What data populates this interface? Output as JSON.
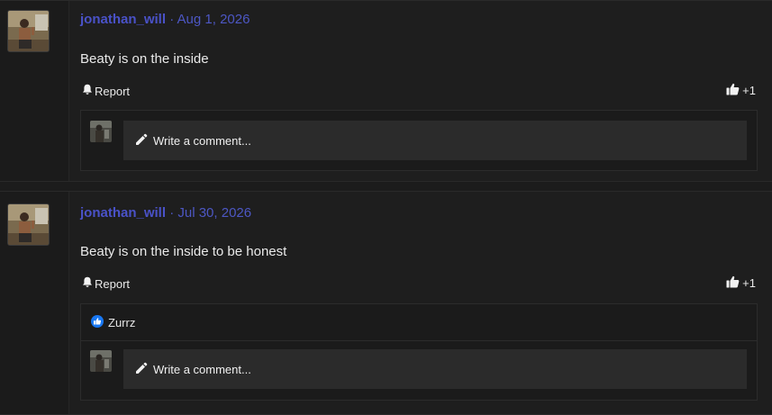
{
  "posts": [
    {
      "username": "jonathan_will",
      "separator": "·",
      "date": "Aug 1, 2026",
      "text": "Beaty is on the inside",
      "report_label": "Report",
      "like_label": "+1",
      "reactions": null,
      "comment_placeholder": "Write a comment..."
    },
    {
      "username": "jonathan_will",
      "separator": "·",
      "date": "Jul 30, 2026",
      "text": "Beaty is on the inside to be honest",
      "report_label": "Report",
      "like_label": "+1",
      "reactions": {
        "icon": "thumbs-up-reaction-icon",
        "user": "Zurrz"
      },
      "comment_placeholder": "Write a comment..."
    }
  ],
  "colors": {
    "background": "#1c1c1c",
    "username": "#4a52c8",
    "date": "#4d57c4",
    "text": "#eaeaea",
    "input_bg": "#2b2b2b",
    "reaction_blue": "#1877f2"
  },
  "icons": {
    "report": "bell-icon",
    "like": "thumbs-up-icon",
    "comment": "pencil-icon"
  }
}
